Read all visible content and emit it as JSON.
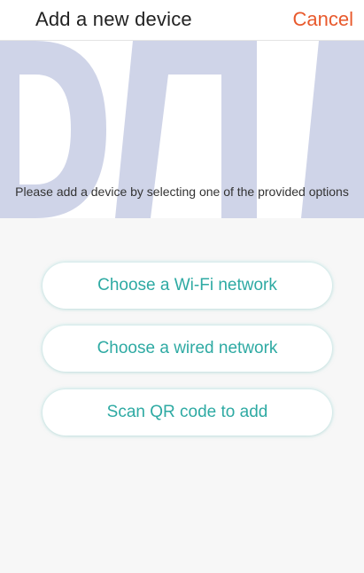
{
  "header": {
    "title": "Add a new device",
    "cancel_label": "Cancel"
  },
  "main": {
    "instructions": "Please add a device by selecting one of the provided options",
    "options": [
      {
        "label": "Choose a Wi-Fi network"
      },
      {
        "label": "Choose a wired network"
      },
      {
        "label": "Scan QR code to add"
      }
    ]
  },
  "colors": {
    "accent": "#2eaaa3",
    "cancel": "#e8592c",
    "watermark": "#c7cde4",
    "background": "#f7f7f7"
  }
}
